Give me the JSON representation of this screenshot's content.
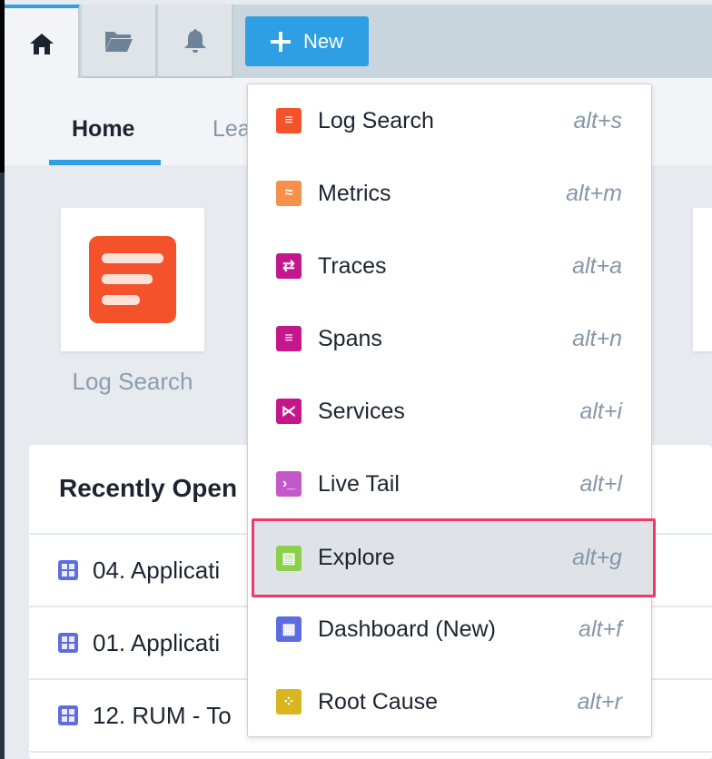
{
  "topbar": {
    "tabs": [
      {
        "name": "home",
        "active": true
      },
      {
        "name": "library"
      },
      {
        "name": "alerts"
      }
    ],
    "new_label": "New"
  },
  "subtabs": {
    "home": "Home",
    "second": "Lea"
  },
  "tiles": {
    "log_search": "Log Search"
  },
  "recent": {
    "title": "Recently Open",
    "rows": [
      "04. Applicati",
      "01. Applicati",
      "12. RUM - To"
    ]
  },
  "menu": {
    "items": [
      {
        "label": "Log Search",
        "shortcut": "alt+s",
        "color": "#f4522a",
        "icon": "log-search-icon"
      },
      {
        "label": "Metrics",
        "shortcut": "alt+m",
        "color": "#f7904a",
        "icon": "metrics-icon"
      },
      {
        "label": "Traces",
        "shortcut": "alt+a",
        "color": "#c4178c",
        "icon": "traces-icon"
      },
      {
        "label": "Spans",
        "shortcut": "alt+n",
        "color": "#c4178c",
        "icon": "spans-icon"
      },
      {
        "label": "Services",
        "shortcut": "alt+i",
        "color": "#c4178c",
        "icon": "services-icon"
      },
      {
        "label": "Live Tail",
        "shortcut": "alt+l",
        "color": "#c358c9",
        "icon": "live-tail-icon"
      },
      {
        "label": "Explore",
        "shortcut": "alt+g",
        "color": "#8ccf4d",
        "icon": "explore-icon",
        "highlighted": true
      },
      {
        "label": "Dashboard (New)",
        "shortcut": "alt+f",
        "color": "#5d6de0",
        "icon": "dashboard-icon"
      },
      {
        "label": "Root Cause",
        "shortcut": "alt+r",
        "color": "#d9b51f",
        "icon": "root-cause-icon"
      }
    ]
  }
}
